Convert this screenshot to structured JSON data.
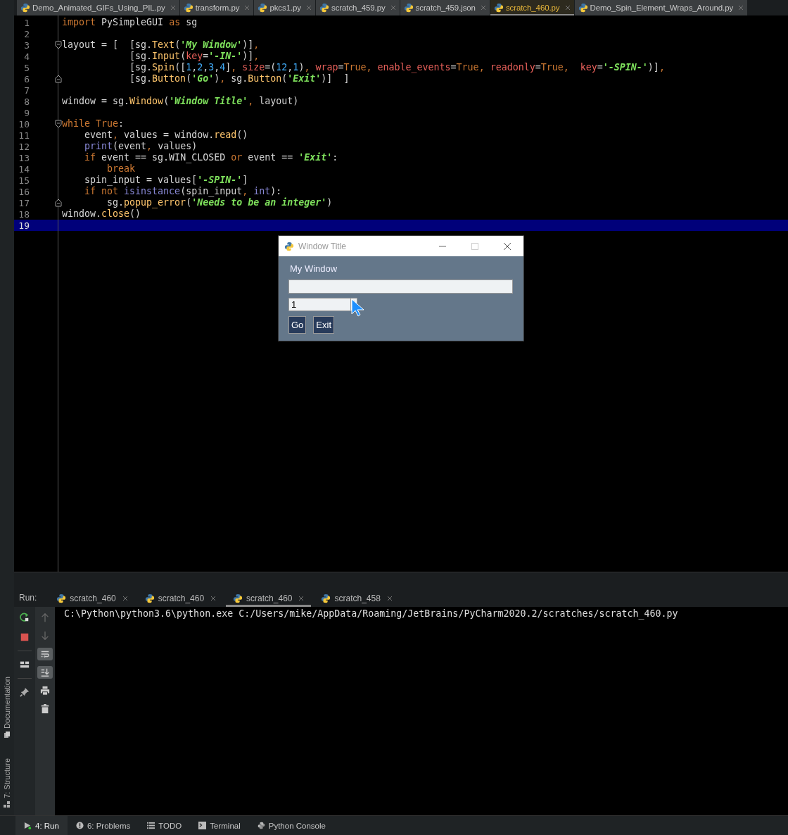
{
  "editor_tabs": [
    {
      "label": "Demo_Animated_GIFs_Using_PIL.py",
      "selected": false
    },
    {
      "label": "transform.py",
      "selected": false
    },
    {
      "label": "pkcs1.py",
      "selected": false
    },
    {
      "label": "scratch_459.py",
      "selected": false
    },
    {
      "label": "scratch_459.json",
      "selected": false
    },
    {
      "label": "scratch_460.py",
      "selected": true
    },
    {
      "label": "Demo_Spin_Element_Wraps_Around.py",
      "selected": false
    }
  ],
  "editor": {
    "lines": [
      {
        "number": "1",
        "current": false,
        "fold_start": false,
        "fold_end": false,
        "tokens": [
          {
            "text": "import",
            "kind": "keyword"
          },
          {
            "text": " PySimpleGUI ",
            "kind": "plain"
          },
          {
            "text": "as",
            "kind": "keyword"
          },
          {
            "text": " sg",
            "kind": "plain"
          }
        ]
      },
      {
        "number": "2",
        "current": false,
        "fold_start": false,
        "fold_end": false
      },
      {
        "number": "3",
        "current": false,
        "fold_start": true,
        "fold_end": false,
        "tokens": [
          {
            "text": "layout = [  [sg.",
            "kind": "plain"
          },
          {
            "text": "Text",
            "kind": "call"
          },
          {
            "text": "(",
            "kind": "plain"
          },
          {
            "text": "'My Window'",
            "kind": "string"
          },
          {
            "text": ")]",
            "kind": "plain"
          },
          {
            "text": ",",
            "kind": "keyword"
          }
        ]
      },
      {
        "number": "4",
        "current": false,
        "fold_start": false,
        "fold_end": false,
        "tokens": [
          {
            "text": "            [sg.",
            "kind": "plain"
          },
          {
            "text": "Input",
            "kind": "call"
          },
          {
            "text": "(",
            "kind": "plain"
          },
          {
            "text": "key",
            "kind": "param"
          },
          {
            "text": "=",
            "kind": "plain"
          },
          {
            "text": "'-IN-'",
            "kind": "string"
          },
          {
            "text": ")]",
            "kind": "plain"
          },
          {
            "text": ",",
            "kind": "keyword"
          }
        ]
      },
      {
        "number": "5",
        "current": false,
        "fold_start": false,
        "fold_end": false,
        "tokens": [
          {
            "text": "            [sg.",
            "kind": "plain"
          },
          {
            "text": "Spin",
            "kind": "call"
          },
          {
            "text": "([",
            "kind": "plain"
          },
          {
            "text": "1",
            "kind": "number"
          },
          {
            "text": ",",
            "kind": "plain"
          },
          {
            "text": "2",
            "kind": "number"
          },
          {
            "text": ",",
            "kind": "plain"
          },
          {
            "text": "3",
            "kind": "number"
          },
          {
            "text": ",",
            "kind": "plain"
          },
          {
            "text": "4",
            "kind": "number"
          },
          {
            "text": "]",
            "kind": "plain"
          },
          {
            "text": ", ",
            "kind": "keyword"
          },
          {
            "text": "size",
            "kind": "param"
          },
          {
            "text": "=(",
            "kind": "plain"
          },
          {
            "text": "12",
            "kind": "number"
          },
          {
            "text": ",",
            "kind": "plain"
          },
          {
            "text": "1",
            "kind": "number"
          },
          {
            "text": ")",
            "kind": "plain"
          },
          {
            "text": ", ",
            "kind": "keyword"
          },
          {
            "text": "wrap",
            "kind": "param"
          },
          {
            "text": "=",
            "kind": "plain"
          },
          {
            "text": "True",
            "kind": "keyword"
          },
          {
            "text": ", ",
            "kind": "keyword"
          },
          {
            "text": "enable_events",
            "kind": "param"
          },
          {
            "text": "=",
            "kind": "plain"
          },
          {
            "text": "True",
            "kind": "keyword"
          },
          {
            "text": ", ",
            "kind": "keyword"
          },
          {
            "text": "readonly",
            "kind": "param"
          },
          {
            "text": "=",
            "kind": "plain"
          },
          {
            "text": "True",
            "kind": "keyword"
          },
          {
            "text": ",  ",
            "kind": "keyword"
          },
          {
            "text": "key",
            "kind": "param"
          },
          {
            "text": "=",
            "kind": "plain"
          },
          {
            "text": "'-SPIN-'",
            "kind": "string"
          },
          {
            "text": ")]",
            "kind": "plain"
          },
          {
            "text": ",",
            "kind": "keyword"
          }
        ]
      },
      {
        "number": "6",
        "current": false,
        "fold_start": false,
        "fold_end": true,
        "tokens": [
          {
            "text": "            [sg.",
            "kind": "plain"
          },
          {
            "text": "Button",
            "kind": "call"
          },
          {
            "text": "(",
            "kind": "plain"
          },
          {
            "text": "'Go'",
            "kind": "string"
          },
          {
            "text": ")",
            "kind": "plain"
          },
          {
            "text": ", ",
            "kind": "keyword"
          },
          {
            "text": "sg.",
            "kind": "plain"
          },
          {
            "text": "Button",
            "kind": "call"
          },
          {
            "text": "(",
            "kind": "plain"
          },
          {
            "text": "'Exit'",
            "kind": "string"
          },
          {
            "text": ")]  ]",
            "kind": "plain"
          }
        ]
      },
      {
        "number": "7",
        "current": false,
        "fold_start": false,
        "fold_end": false
      },
      {
        "number": "8",
        "current": false,
        "fold_start": false,
        "fold_end": false,
        "tokens": [
          {
            "text": "window = sg.",
            "kind": "plain"
          },
          {
            "text": "Window",
            "kind": "call"
          },
          {
            "text": "(",
            "kind": "plain"
          },
          {
            "text": "'Window Title'",
            "kind": "string"
          },
          {
            "text": ", ",
            "kind": "keyword"
          },
          {
            "text": "layout)",
            "kind": "plain"
          }
        ]
      },
      {
        "number": "9",
        "current": false,
        "fold_start": false,
        "fold_end": false
      },
      {
        "number": "10",
        "current": false,
        "fold_start": true,
        "fold_end": false,
        "tokens": [
          {
            "text": "while ",
            "kind": "keyword"
          },
          {
            "text": "True",
            "kind": "keyword"
          },
          {
            "text": ":",
            "kind": "plain"
          }
        ]
      },
      {
        "number": "11",
        "current": false,
        "fold_start": false,
        "fold_end": false,
        "tokens": [
          {
            "text": "    event",
            "kind": "plain"
          },
          {
            "text": ", ",
            "kind": "keyword"
          },
          {
            "text": "values = window.",
            "kind": "plain"
          },
          {
            "text": "read",
            "kind": "call"
          },
          {
            "text": "()",
            "kind": "plain"
          }
        ]
      },
      {
        "number": "12",
        "current": false,
        "fold_start": false,
        "fold_end": false,
        "tokens": [
          {
            "text": "    print",
            "kind": "builtin"
          },
          {
            "text": "(event",
            "kind": "plain"
          },
          {
            "text": ", ",
            "kind": "keyword"
          },
          {
            "text": "values)",
            "kind": "plain"
          }
        ]
      },
      {
        "number": "13",
        "current": false,
        "fold_start": false,
        "fold_end": false,
        "tokens": [
          {
            "text": "    if",
            "kind": "keyword"
          },
          {
            "text": " event == sg.WIN_CLOSED ",
            "kind": "plain"
          },
          {
            "text": "or",
            "kind": "keyword"
          },
          {
            "text": " event == ",
            "kind": "plain"
          },
          {
            "text": "'Exit'",
            "kind": "string"
          },
          {
            "text": ":",
            "kind": "plain"
          }
        ]
      },
      {
        "number": "14",
        "current": false,
        "fold_start": false,
        "fold_end": false,
        "tokens": [
          {
            "text": "        break",
            "kind": "keyword"
          }
        ]
      },
      {
        "number": "15",
        "current": false,
        "fold_start": false,
        "fold_end": false,
        "tokens": [
          {
            "text": "    spin_input = values[",
            "kind": "plain"
          },
          {
            "text": "'-SPIN-'",
            "kind": "string"
          },
          {
            "text": "]",
            "kind": "plain"
          }
        ]
      },
      {
        "number": "16",
        "current": false,
        "fold_start": false,
        "fold_end": false,
        "tokens": [
          {
            "text": "    if not ",
            "kind": "keyword"
          },
          {
            "text": "isinstance",
            "kind": "builtin"
          },
          {
            "text": "(spin_input",
            "kind": "plain"
          },
          {
            "text": ", ",
            "kind": "keyword"
          },
          {
            "text": "int",
            "kind": "builtin"
          },
          {
            "text": "):",
            "kind": "plain"
          }
        ]
      },
      {
        "number": "17",
        "current": false,
        "fold_start": false,
        "fold_end": true,
        "tokens": [
          {
            "text": "        sg.",
            "kind": "plain"
          },
          {
            "text": "popup_error",
            "kind": "call"
          },
          {
            "text": "(",
            "kind": "plain"
          },
          {
            "text": "'Needs to be an integer'",
            "kind": "string"
          },
          {
            "text": ")",
            "kind": "plain"
          }
        ]
      },
      {
        "number": "18",
        "current": false,
        "fold_start": false,
        "fold_end": false,
        "tokens": [
          {
            "text": "window.",
            "kind": "plain"
          },
          {
            "text": "close",
            "kind": "call"
          },
          {
            "text": "()",
            "kind": "plain"
          }
        ]
      },
      {
        "number": "19",
        "current": true,
        "fold_start": false,
        "fold_end": false
      }
    ]
  },
  "popup_window": {
    "title": "Window Title",
    "text": "My Window",
    "spin": {
      "value": "1"
    },
    "buttons": [
      "Go",
      "Exit"
    ]
  },
  "run_panel": {
    "title": "Run:",
    "tabs": [
      {
        "label": "scratch_460",
        "selected": false
      },
      {
        "label": "scratch_460",
        "selected": false
      },
      {
        "label": "scratch_460",
        "selected": true
      },
      {
        "label": "scratch_458",
        "selected": false
      }
    ],
    "tools": [
      {
        "kind": "rerun",
        "on": false
      },
      {
        "kind": "stop",
        "on": false
      },
      {
        "kind": "layout",
        "on": false
      },
      {
        "kind": "pin",
        "on": false
      }
    ],
    "console_tools": [
      {
        "kind": "up",
        "on": false
      },
      {
        "kind": "down",
        "on": false
      },
      {
        "kind": "wrap",
        "on": true
      },
      {
        "kind": "scroll",
        "on": true
      },
      {
        "kind": "print",
        "on": false
      },
      {
        "kind": "trash",
        "on": false
      }
    ],
    "console_lines": [
      "C:\\Python\\python3.6\\python.exe C:/Users/mike/AppData/Roaming/JetBrains/PyCharm2020.2/scratches/scratch_460.py"
    ]
  },
  "side_tabs": [
    "Documentation",
    "7: Structure"
  ],
  "bottom_bar": [
    {
      "label": "4: Run",
      "selected": true
    },
    {
      "label": "6: Problems",
      "selected": false
    },
    {
      "label": "TODO",
      "selected": false
    },
    {
      "label": "Terminal",
      "selected": false
    },
    {
      "label": "Python Console",
      "selected": false
    }
  ]
}
